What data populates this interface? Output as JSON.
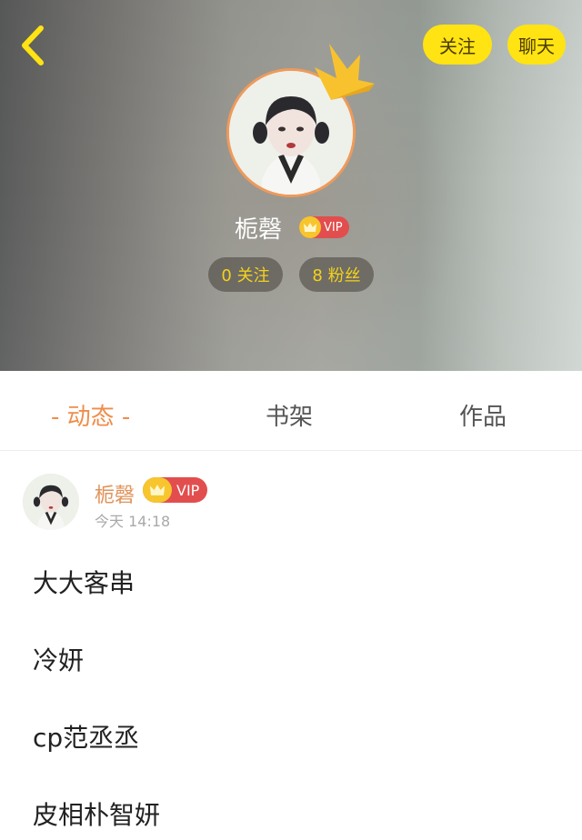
{
  "header": {
    "follow_label": "关注",
    "chat_label": "聊天",
    "nickname": "栀磬",
    "vip_label": "VIP",
    "following_stat": "0 关注",
    "fans_stat": "8 粉丝"
  },
  "tabs": [
    {
      "label": "- 动态 -",
      "active": true
    },
    {
      "label": "书架",
      "active": false
    },
    {
      "label": "作品",
      "active": false
    }
  ],
  "post": {
    "author": "栀磬",
    "vip_label": "VIP",
    "time": "今天 14:18",
    "lines": [
      "大大客串",
      "冷妍",
      "cp范丞丞",
      "皮相朴智妍"
    ]
  },
  "colors": {
    "accent_yellow": "#ffe312",
    "tab_active": "#ef8d4b",
    "vip_red": "#e24e4e",
    "avatar_ring": "#ef9a5a"
  },
  "icons": {
    "back": "chevron-left-icon",
    "crown": "crown-icon"
  }
}
